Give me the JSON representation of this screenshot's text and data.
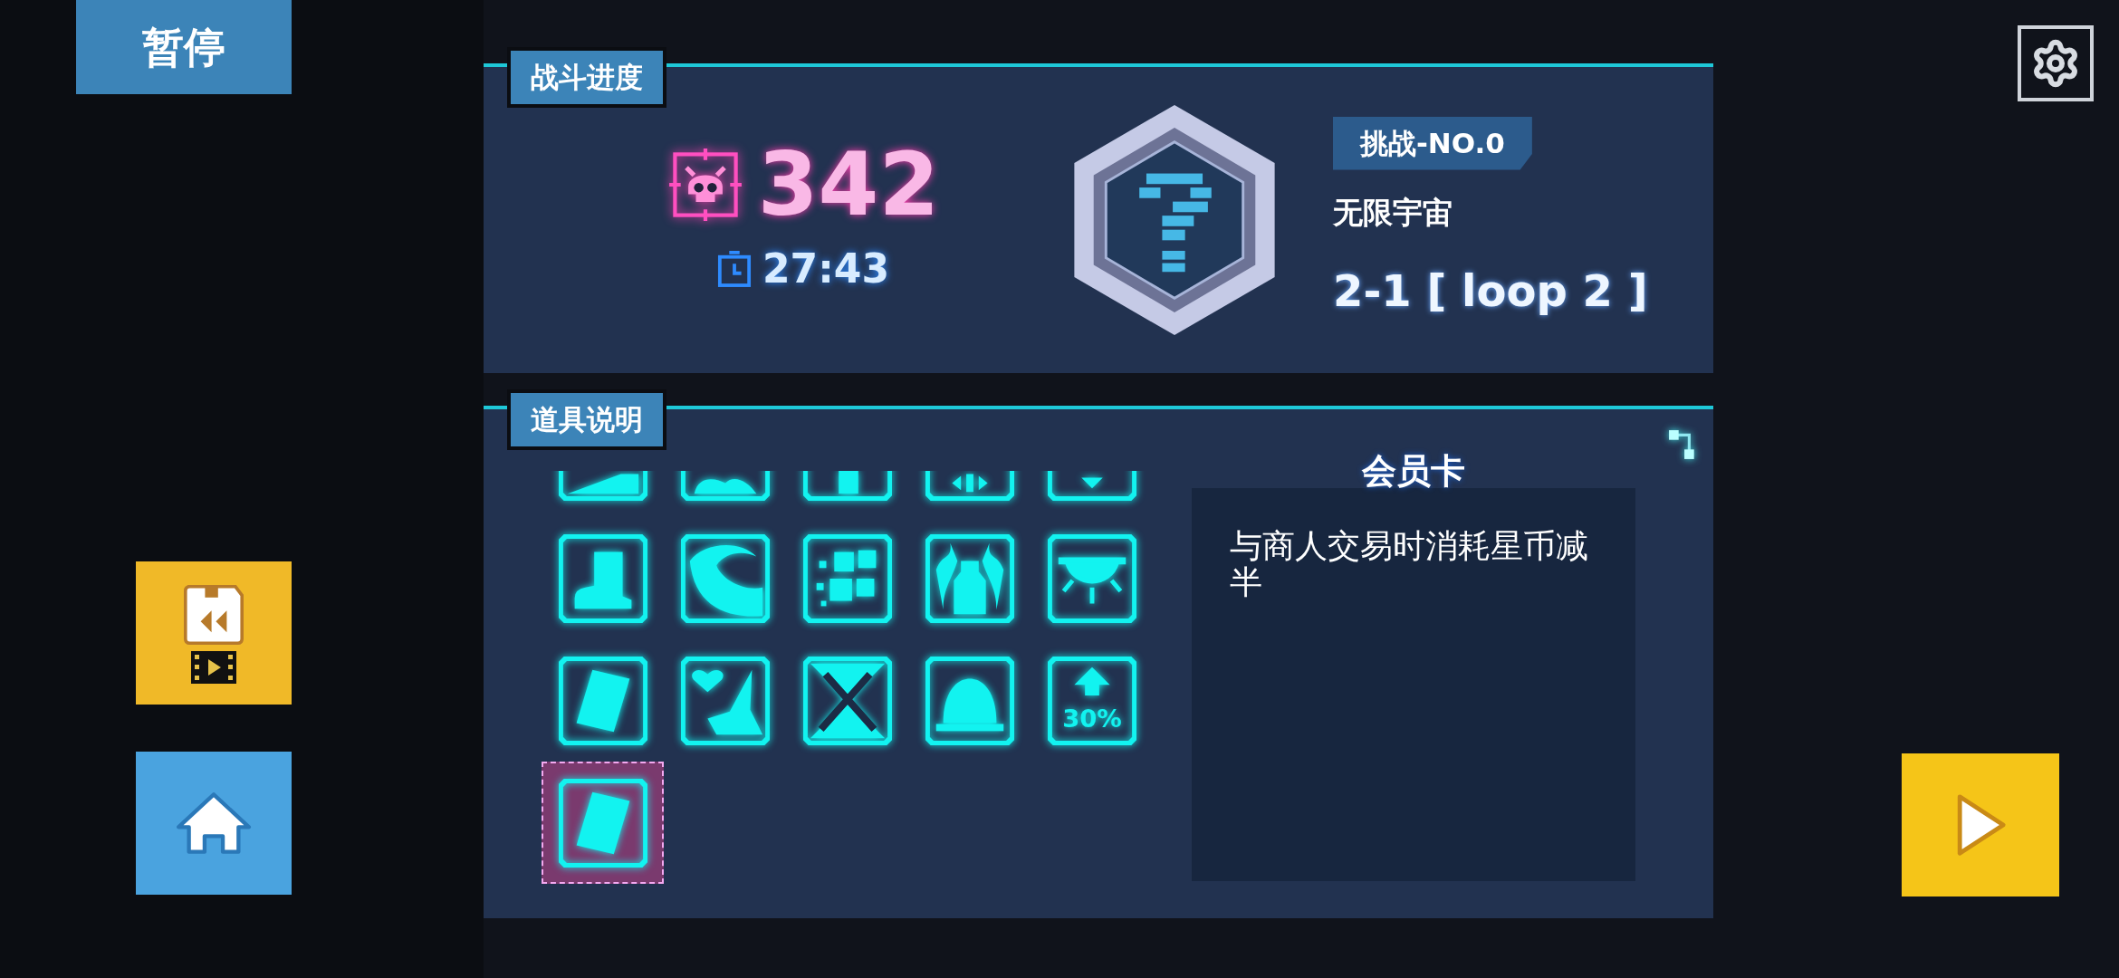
{
  "pause_label": "暂停",
  "battle_progress": {
    "title": "战斗进度",
    "kills": "342",
    "time": "27:43",
    "challenge": "挑战-NO.0",
    "mode": "无限宇宙",
    "stage": "2-1 [ loop 2 ]"
  },
  "item_info": {
    "title": "道具说明",
    "items": [
      {
        "kind": "ramp",
        "selected": false
      },
      {
        "kind": "splash",
        "selected": false
      },
      {
        "kind": "bar",
        "selected": false
      },
      {
        "kind": "arrows",
        "selected": false
      },
      {
        "kind": "chevron",
        "selected": false
      },
      {
        "kind": "boot",
        "selected": false
      },
      {
        "kind": "wave",
        "selected": false
      },
      {
        "kind": "blocks",
        "selected": false
      },
      {
        "kind": "bottle",
        "selected": false
      },
      {
        "kind": "eye",
        "selected": false
      },
      {
        "kind": "card",
        "selected": false
      },
      {
        "kind": "heart",
        "selected": false
      },
      {
        "kind": "swords",
        "selected": false
      },
      {
        "kind": "dome",
        "selected": false
      },
      {
        "kind": "percent",
        "selected": false,
        "label": "30%"
      },
      {
        "kind": "card",
        "selected": true
      }
    ],
    "detail": {
      "name": "会员卡",
      "description": "与商人交易时消耗星币减半"
    }
  }
}
